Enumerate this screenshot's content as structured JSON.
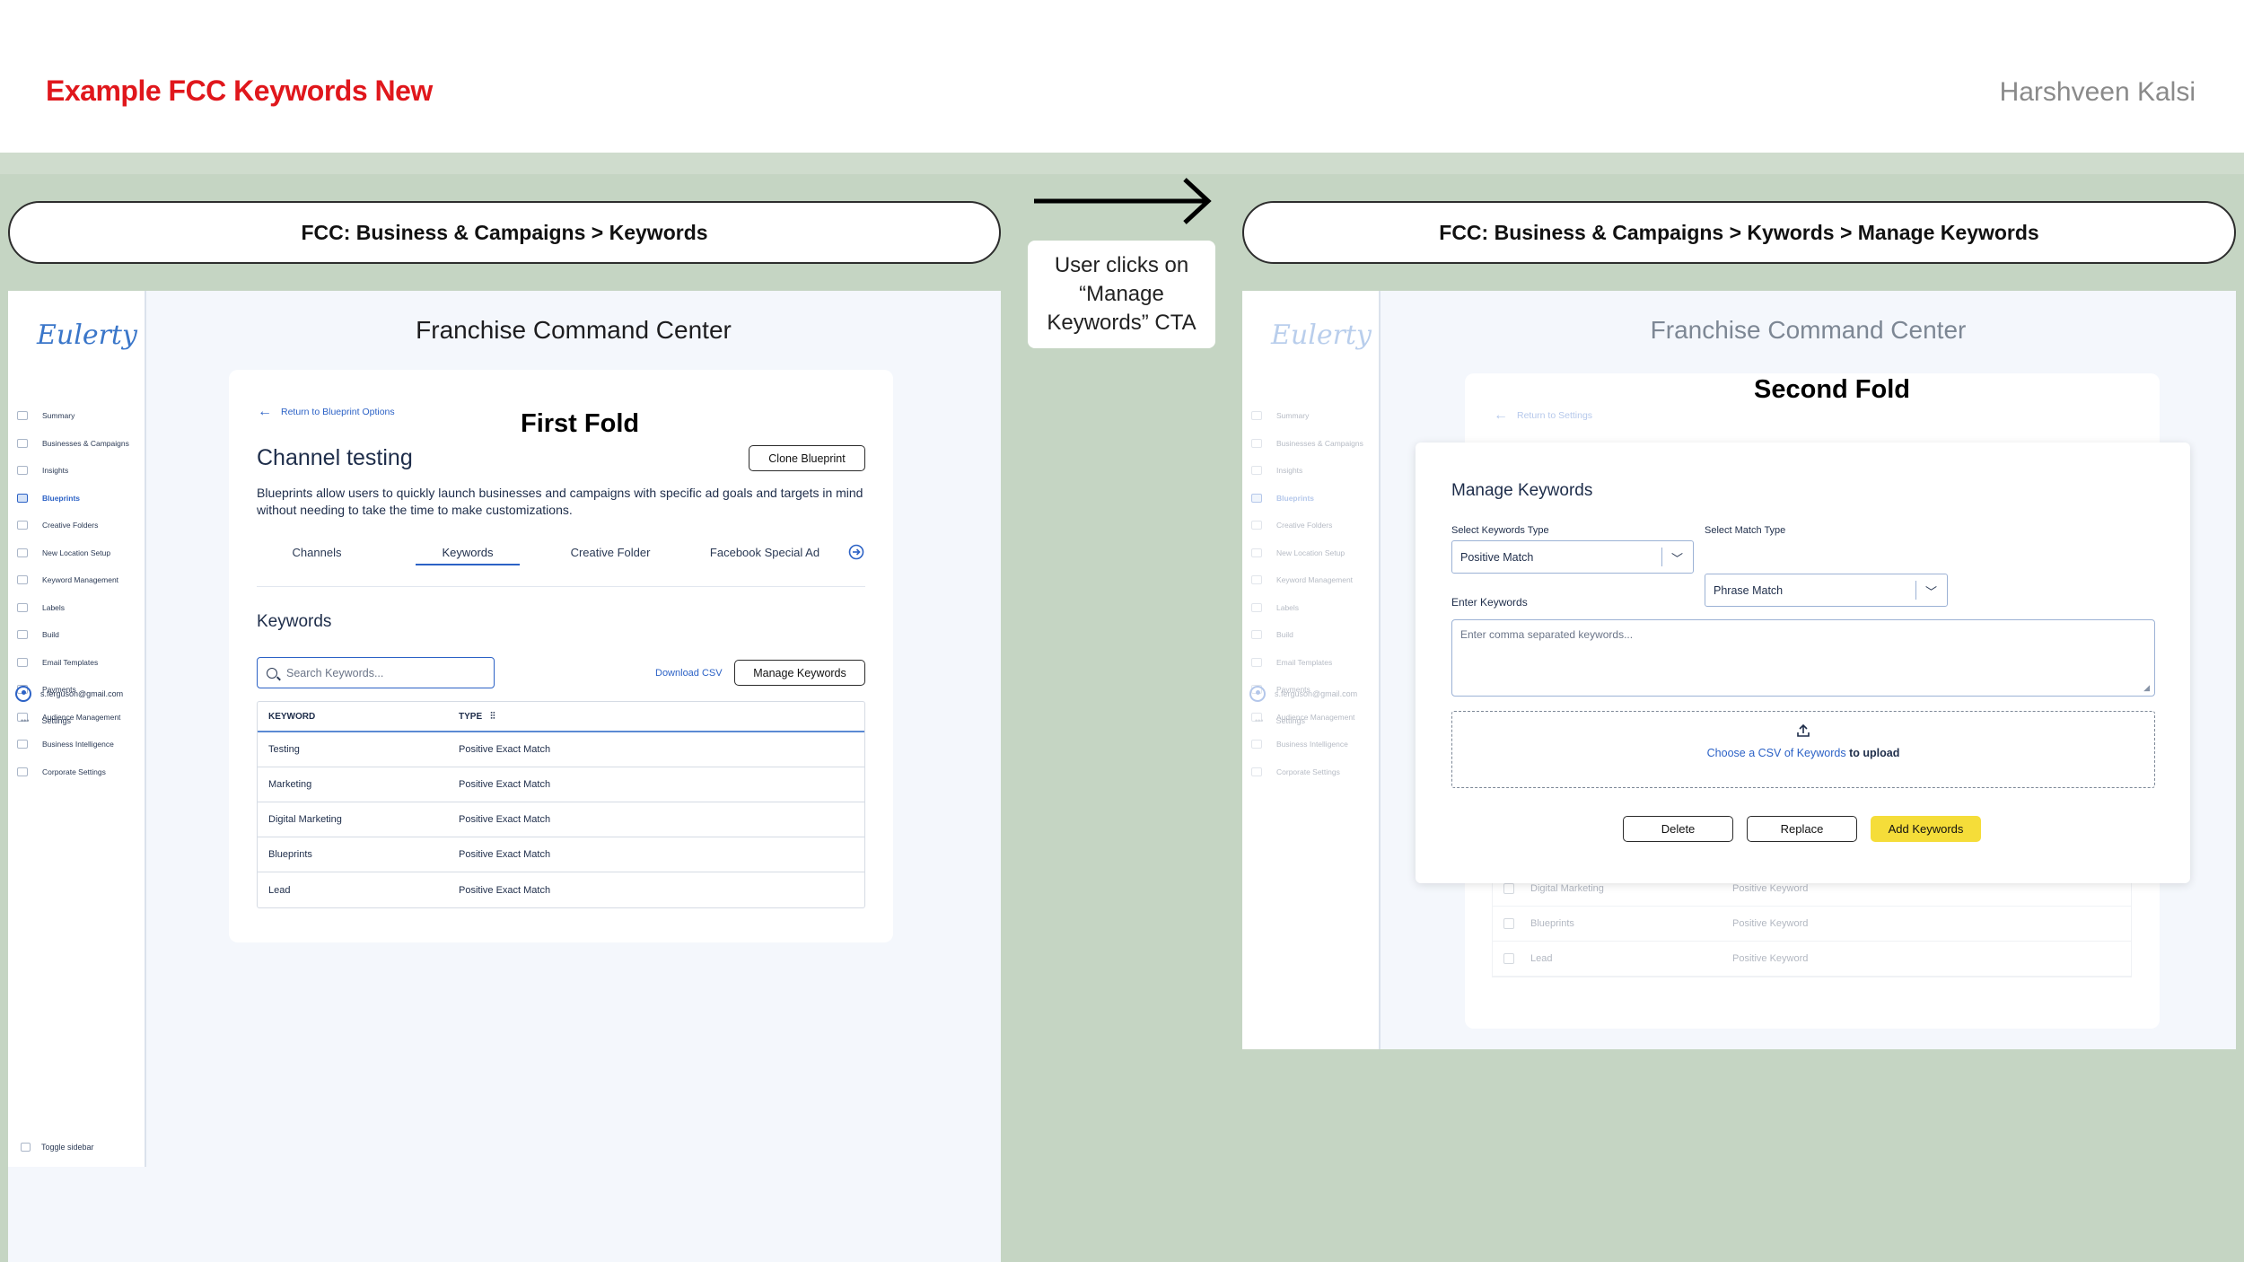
{
  "slide": {
    "title": "Example FCC Keywords New",
    "author": "Harshveen Kalsi",
    "note": "User clicks on “Manage Keywords” CTA"
  },
  "left": {
    "breadcrumb": "FCC: Business & Campaigns > Keywords",
    "logo": "Eulerty",
    "app_title": "Franchise Command Center",
    "nav": [
      {
        "label": "Summary",
        "icon": "summary-icon"
      },
      {
        "label": "Businesses & Campaigns",
        "icon": "location-pin-icon"
      },
      {
        "label": "Insights",
        "icon": "insights-icon"
      },
      {
        "label": "Blueprints",
        "icon": "blueprint-icon",
        "active": true
      },
      {
        "label": "Creative Folders",
        "icon": "folder-icon"
      },
      {
        "label": "New Location Setup",
        "icon": "location-icon"
      },
      {
        "label": "Keyword Management",
        "icon": "lock-icon"
      },
      {
        "label": "Labels",
        "icon": "label-icon"
      },
      {
        "label": "Build",
        "icon": "build-icon"
      },
      {
        "label": "Email Templates",
        "icon": "email-icon"
      },
      {
        "label": "Payments",
        "icon": "payments-icon"
      },
      {
        "label": "Audience Management",
        "icon": "audience-icon"
      },
      {
        "label": "Business Intelligence",
        "icon": "intelligence-icon"
      },
      {
        "label": "Corporate Settings",
        "icon": "settings-icon"
      }
    ],
    "user_email": "s.ferguson@gmail.com",
    "settings": "Settings",
    "toggle_sidebar": "Toggle sidebar",
    "back_link": "Return to Blueprint Options",
    "fold_label": "First Fold",
    "channel_title": "Channel testing",
    "clone_button": "Clone Blueprint",
    "description": "Blueprints allow users to quickly launch businesses and campaigns with specific ad goals and targets in mind without needing to take the time to make customizations.",
    "tabs": [
      "Channels",
      "Keywords",
      "Creative Folder",
      "Facebook Special Ad"
    ],
    "active_tab": "Keywords",
    "section_title": "Keywords",
    "search_placeholder": "Search Keywords...",
    "download_csv": "Download CSV",
    "manage_button": "Manage Keywords",
    "table": {
      "headers": [
        "KEYWORD",
        "TYPE"
      ],
      "rows": [
        [
          "Testing",
          "Positive Exact Match"
        ],
        [
          "Marketing",
          "Positive Exact Match"
        ],
        [
          "Digital Marketing",
          "Positive Exact Match"
        ],
        [
          "Blueprints",
          "Positive Exact Match"
        ],
        [
          "Lead",
          "Positive Exact Match"
        ]
      ]
    }
  },
  "right": {
    "breadcrumb": "FCC: Business & Campaigns > Kywords > Manage Keywords",
    "app_title": "Franchise Command Center",
    "fold_label": "Second Fold",
    "back_link": "Return to Settings",
    "modal": {
      "title": "Manage Keywords",
      "keywords_type_label": "Select Keywords Type",
      "keywords_type_value": "Positive Match",
      "match_type_label": "Select Match Type",
      "match_type_value": "Phrase Match",
      "enter_label": "Enter Keywords",
      "textarea_placeholder": "Enter comma separated keywords...",
      "upload_link": "Choose a CSV of Keywords",
      "upload_suffix": "to upload",
      "delete_button": "Delete",
      "replace_button": "Replace",
      "add_button": "Add Keywords"
    },
    "background_rows": [
      [
        "Digital Marketing",
        "Positive Keyword"
      ],
      [
        "Blueprints",
        "Positive Keyword"
      ],
      [
        "Lead",
        "Positive Keyword"
      ]
    ]
  },
  "colors": {
    "title_red": "#e0171c",
    "band_green": "#c5d5c3",
    "link_blue": "#2c62c6",
    "primary_yellow": "#f5dd39"
  }
}
